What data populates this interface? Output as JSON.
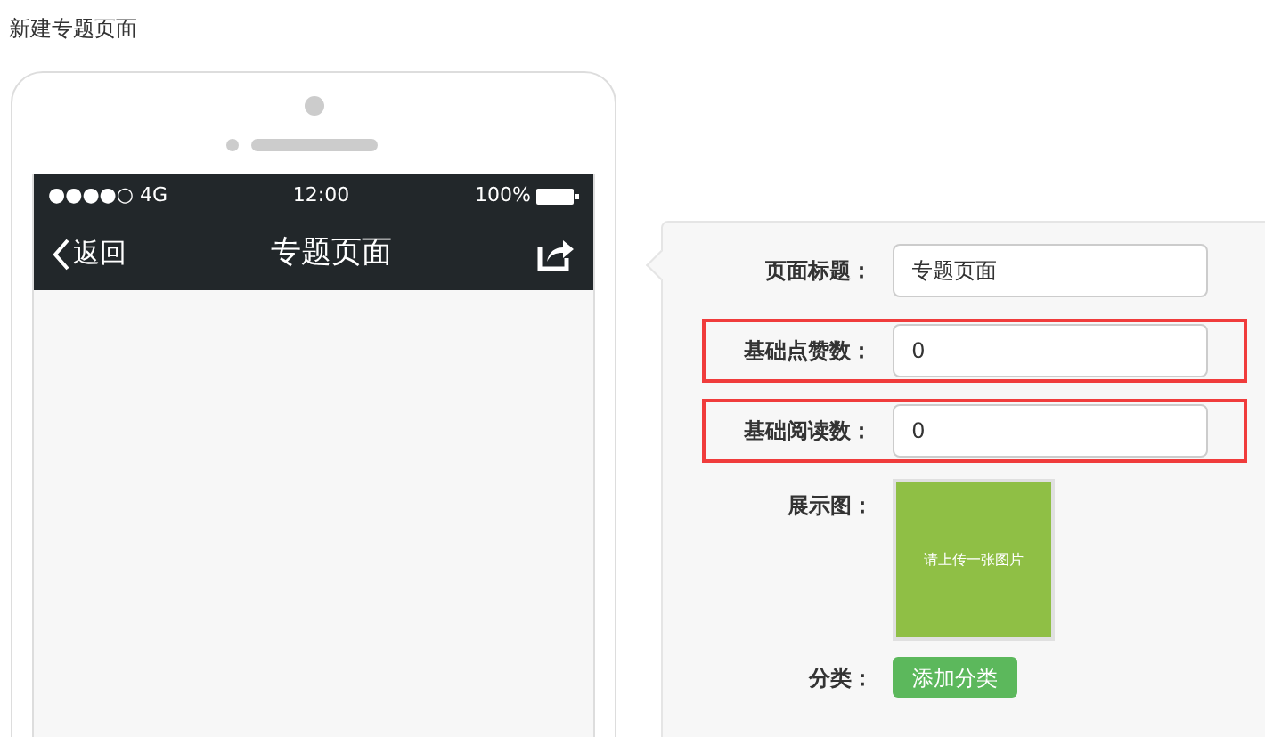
{
  "page_title": "新建专题页面",
  "phone": {
    "status_bar": {
      "signal": "●●●●○ 4G",
      "time": "12:00",
      "battery": "100%"
    },
    "nav": {
      "back": "返回",
      "title": "专题页面"
    }
  },
  "form": {
    "fields": [
      {
        "label": "页面标题：",
        "value": "专题页面",
        "highlighted": false
      },
      {
        "label": "基础点赞数：",
        "value": "0",
        "highlighted": true
      },
      {
        "label": "基础阅读数：",
        "value": "0",
        "highlighted": true
      }
    ],
    "image": {
      "label": "展示图：",
      "placeholder": "请上传一张图片"
    },
    "category": {
      "label": "分类：",
      "button": "添加分类"
    }
  }
}
